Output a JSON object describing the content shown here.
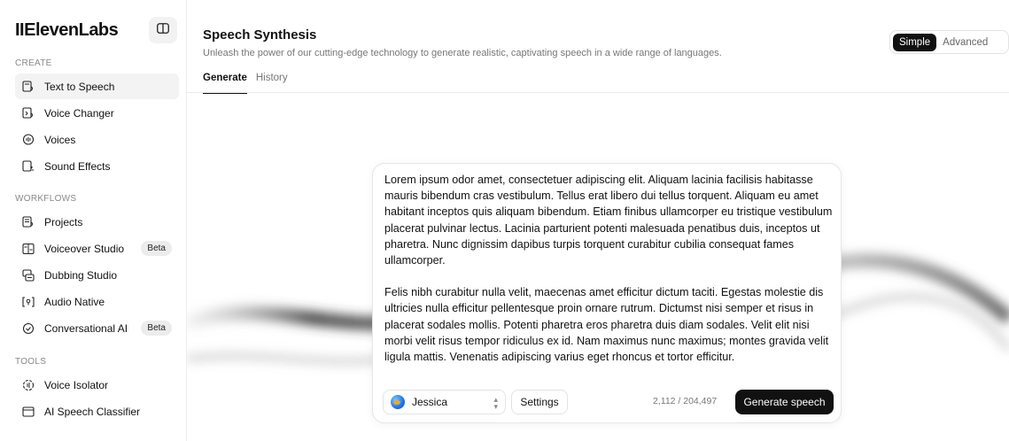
{
  "sidebar": {
    "logo": "IIElevenLabs",
    "sections": {
      "create": "CREATE",
      "workflows": "WORKFLOWS",
      "tools": "TOOLS"
    },
    "create_items": [
      {
        "label": "Text to Speech",
        "icon": "text-to-speech-icon"
      },
      {
        "label": "Voice Changer",
        "icon": "voice-changer-icon"
      },
      {
        "label": "Voices",
        "icon": "voices-icon"
      },
      {
        "label": "Sound Effects",
        "icon": "sound-effects-icon"
      }
    ],
    "workflow_items": [
      {
        "label": "Projects",
        "icon": "projects-icon"
      },
      {
        "label": "Voiceover Studio",
        "icon": "voiceover-studio-icon",
        "badge": "Beta"
      },
      {
        "label": "Dubbing Studio",
        "icon": "dubbing-studio-icon"
      },
      {
        "label": "Audio Native",
        "icon": "audio-native-icon"
      },
      {
        "label": "Conversational AI",
        "icon": "conversational-ai-icon",
        "badge": "Beta"
      }
    ],
    "tool_items": [
      {
        "label": "Voice Isolator",
        "icon": "voice-isolator-icon"
      },
      {
        "label": "AI Speech Classifier",
        "icon": "speech-classifier-icon"
      }
    ]
  },
  "header": {
    "title": "Speech Synthesis",
    "subtitle": "Unleash the power of our cutting-edge technology to generate realistic, captivating speech in a wide range of languages.",
    "modes": [
      "Simple",
      "Advanced"
    ],
    "active_mode": "Simple",
    "tabs": [
      "Generate",
      "History"
    ],
    "active_tab": "Generate"
  },
  "editor": {
    "paragraphs": [
      "Lorem ipsum odor amet, consectetuer adipiscing elit. Aliquam lacinia facilisis habitasse mauris bibendum cras vestibulum. Tellus erat libero dui tellus torquent. Aliquam eu amet habitant inceptos quis aliquam bibendum. Etiam finibus ullamcorper eu tristique vestibulum placerat pulvinar lectus. Lacinia parturient potenti malesuada penatibus duis, inceptos ut pharetra. Nunc dignissim dapibus turpis torquent curabitur cubilia consequat fames ullamcorper.",
      "Felis nibh curabitur nulla velit, maecenas amet efficitur dictum taciti. Egestas molestie dis ultricies nulla efficitur pellentesque proin ornare rutrum. Dictumst nisi semper et risus in placerat sodales mollis. Potenti pharetra eros pharetra duis diam sodales. Velit elit nisi morbi velit risus tempor ridiculus ex id. Nam maximus nunc maximus; montes gravida velit ligula mattis. Venenatis adipiscing varius eget rhoncus et tortor efficitur."
    ],
    "voice": "Jessica",
    "settings_label": "Settings",
    "char_count": "2,112 / 204,497",
    "generate_label": "Generate speech"
  }
}
